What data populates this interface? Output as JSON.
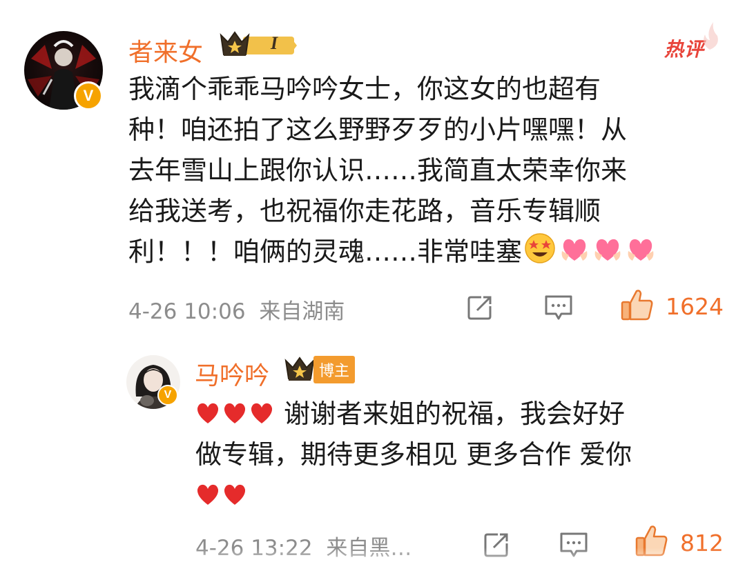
{
  "comment": {
    "username": "者来女",
    "badge_level": "I",
    "hot_label": "热评",
    "lines": [
      "我滴个乖乖马吟吟女士，你这女的也超有",
      "种！咱还拍了这么野野歹歹的小片嘿嘿！从",
      "去年雪山上跟你认识……我简直太荣幸你来",
      "给我送考，也祝福你走花路，音乐专辑顺",
      "利！！！咱俩的灵魂……非常哇塞"
    ],
    "timestamp": "4-26 10:06",
    "location": "来自湖南",
    "like_count": "1624"
  },
  "reply": {
    "username": "马吟吟",
    "author_tag": "博主",
    "line1_text": "谢谢者来姐的祝福，我会好好",
    "line2_text": "做专辑，期待更多相见 更多合作 爱你",
    "timestamp": "4-26 13:22",
    "location": "来自黑…",
    "like_count": "812"
  },
  "colors": {
    "username": "#f06f2a",
    "meta": "#8c8c8c",
    "hot": "#e8443a",
    "verified_badge": "#f6a300"
  }
}
